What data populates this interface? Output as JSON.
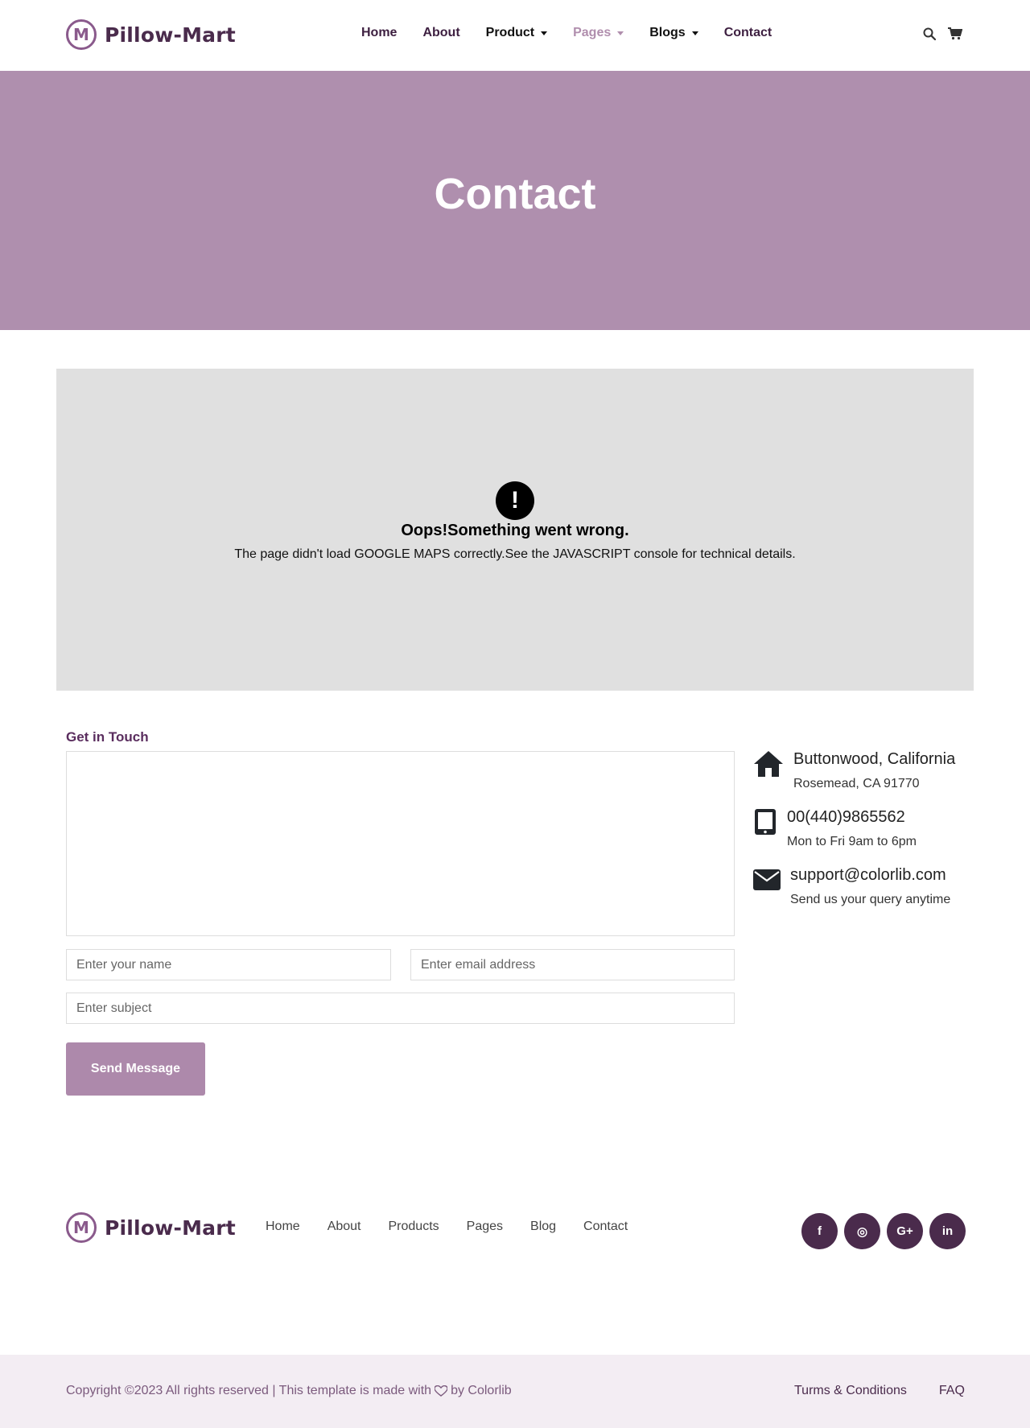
{
  "brand": {
    "name": "Pillow-Mart",
    "mark": "M"
  },
  "nav": {
    "items": [
      {
        "label": "Home"
      },
      {
        "label": "About"
      },
      {
        "label": "Product"
      },
      {
        "label": "Pages"
      },
      {
        "label": "Blogs"
      },
      {
        "label": "Contact"
      }
    ],
    "icons": [
      "search-icon",
      "cart-icon"
    ]
  },
  "banner": {
    "title": "Contact"
  },
  "map_error": {
    "title": "Oops!Something went wrong.",
    "detail": "The page didn't load GOOGLE MAPS correctly.See the JAVASCRIPT console for technical details."
  },
  "form": {
    "heading": "Get in Touch",
    "message_placeholder": "",
    "name_placeholder": "Enter your name",
    "email_placeholder": "Enter email address",
    "subject_placeholder": "Enter subject",
    "send_label": "Send Message"
  },
  "contact_info": [
    {
      "icon": "home-icon",
      "line1": "Buttonwood, California",
      "line2": "Rosemead, CA 91770"
    },
    {
      "icon": "tablet-icon",
      "line1": "00(440)9865562",
      "line2": "Mon to Fri 9am to 6pm"
    },
    {
      "icon": "envelope-icon",
      "line1": "support@colorlib.com",
      "line2": "Send us your query anytime"
    }
  ],
  "footer": {
    "nav": [
      {
        "label": "Home"
      },
      {
        "label": "About"
      },
      {
        "label": "Products"
      },
      {
        "label": "Pages"
      },
      {
        "label": "Blog"
      },
      {
        "label": "Contact"
      }
    ],
    "social": [
      {
        "icon": "facebook-icon",
        "glyph": "f"
      },
      {
        "icon": "instagram-icon",
        "glyph": "◎"
      },
      {
        "icon": "google-plus-icon",
        "glyph": "G+"
      },
      {
        "icon": "linkedin-icon",
        "glyph": "in"
      }
    ],
    "copyright_prefix": "Copyright ©2023 All rights reserved | This template is made with",
    "copyright_suffix": "by Colorlib",
    "links": [
      {
        "label": "Turms & Conditions"
      },
      {
        "label": "FAQ"
      }
    ]
  },
  "colors": {
    "brand": "#4a2b4c",
    "banner": "#af8fae",
    "button": "#ad89ab",
    "footer_bg": "#f3edf3"
  }
}
